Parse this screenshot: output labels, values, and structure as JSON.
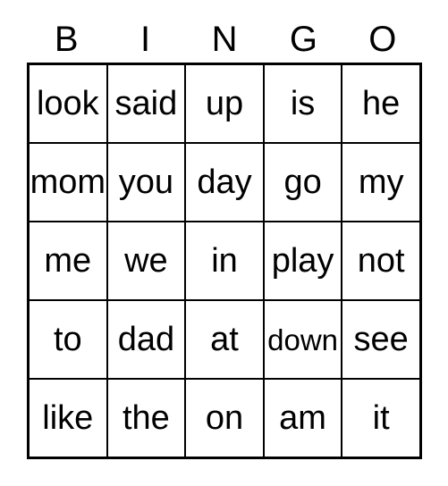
{
  "card": {
    "title_letters": [
      "B",
      "I",
      "N",
      "G",
      "O"
    ],
    "colors": {
      "background": "#ffffff",
      "grid_line": "#000000",
      "text": "#000000"
    },
    "grid": {
      "columns": 5,
      "rows": 5,
      "cells": [
        [
          {
            "text": "look",
            "long": false
          },
          {
            "text": "said",
            "long": false
          },
          {
            "text": "up",
            "long": false
          },
          {
            "text": "is",
            "long": false
          },
          {
            "text": "he",
            "long": false
          }
        ],
        [
          {
            "text": "mom",
            "long": false
          },
          {
            "text": "you",
            "long": false
          },
          {
            "text": "day",
            "long": false
          },
          {
            "text": "go",
            "long": false
          },
          {
            "text": "my",
            "long": false
          }
        ],
        [
          {
            "text": "me",
            "long": false
          },
          {
            "text": "we",
            "long": false
          },
          {
            "text": "in",
            "long": false
          },
          {
            "text": "play",
            "long": false
          },
          {
            "text": "not",
            "long": false
          }
        ],
        [
          {
            "text": "to",
            "long": false
          },
          {
            "text": "dad",
            "long": false
          },
          {
            "text": "at",
            "long": false
          },
          {
            "text": "down",
            "long": true
          },
          {
            "text": "see",
            "long": false
          }
        ],
        [
          {
            "text": "like",
            "long": false
          },
          {
            "text": "the",
            "long": false
          },
          {
            "text": "on",
            "long": false
          },
          {
            "text": "am",
            "long": false
          },
          {
            "text": "it",
            "long": false
          }
        ]
      ]
    }
  }
}
